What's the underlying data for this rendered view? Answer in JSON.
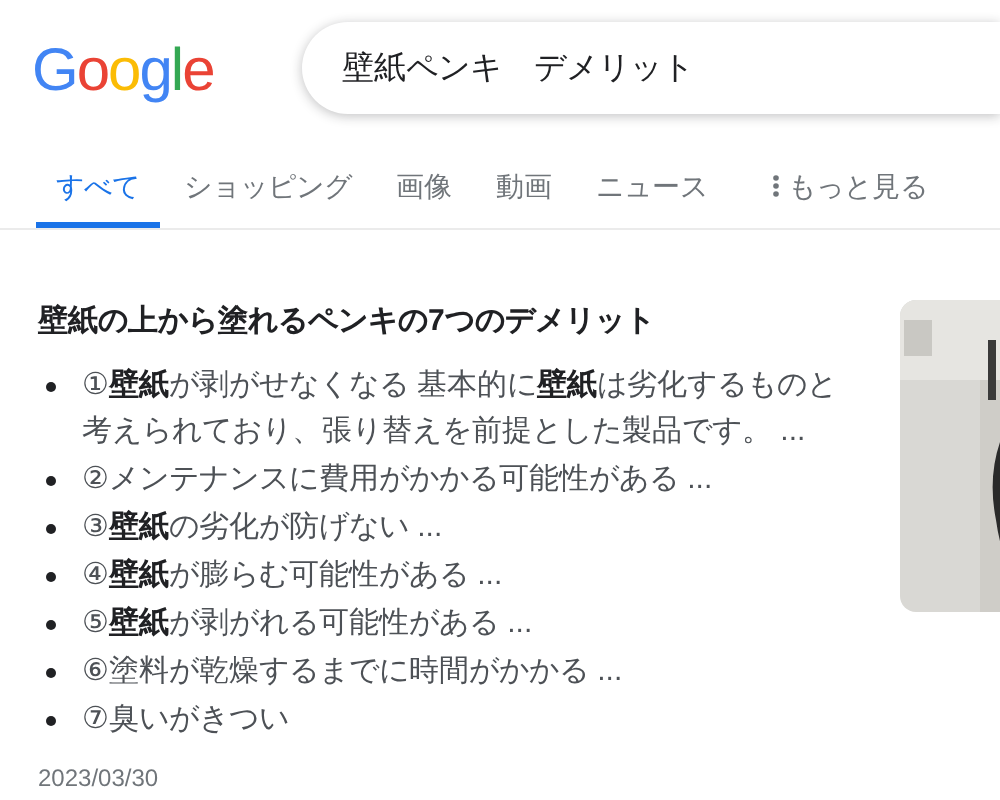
{
  "logo": "Google",
  "search": {
    "value": "壁紙ペンキ　デメリット"
  },
  "tabs": [
    {
      "label": "すべて",
      "selected": true,
      "kind": "tab"
    },
    {
      "label": "ショッピング",
      "selected": false,
      "kind": "tab"
    },
    {
      "label": "画像",
      "selected": false,
      "kind": "tab"
    },
    {
      "label": "動画",
      "selected": false,
      "kind": "tab"
    },
    {
      "label": "ニュース",
      "selected": false,
      "kind": "tab"
    },
    {
      "label": "もっと見る",
      "selected": false,
      "kind": "more"
    }
  ],
  "result": {
    "title": "壁紙の上から塗れるペンキの7つのデメリット",
    "items": [
      "①**壁紙**が剥がせなくなる 基本的に**壁紙**は劣化するものと考えられており、張り替えを前提とした製品です。 ...",
      "②メンテナンスに費用がかかる可能性がある ...",
      "③**壁紙**の劣化が防げない ...",
      "④**壁紙**が膨らむ可能性がある ...",
      "⑤**壁紙**が剥がれる可能性がある ...",
      "⑥塗料が乾燥するまでに時間がかかる ...",
      "⑦臭いがきつい"
    ],
    "date": "2023/03/30"
  }
}
